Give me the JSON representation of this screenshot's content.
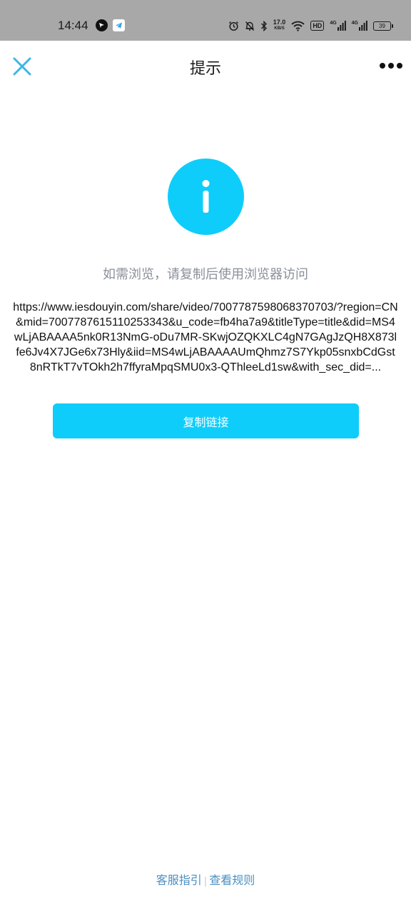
{
  "status_bar": {
    "time": "14:44",
    "net_speed_value": "17.0",
    "net_speed_unit": "KB/S",
    "hd_label": "HD",
    "signal1_label": "4G",
    "signal2_label": "4G",
    "battery": "39",
    "icons": [
      "app-notification-icon",
      "telegram-icon",
      "alarm-icon",
      "mute-bell-icon",
      "bluetooth-icon",
      "wifi-icon",
      "signal-icon",
      "battery-icon"
    ]
  },
  "header": {
    "title": "提示",
    "close_icon": "close-icon",
    "more_icon": "more-icon"
  },
  "main": {
    "info_icon": "info-icon",
    "hint": "如需浏览，请复制后使用浏览器访问",
    "link": "https://www.iesdouyin.com/share/video/7007787598068370703/?region=CN&mid=7007787615110253343&u_code=fb4ha7a9&titleType=title&did=MS4wLjABAAAA5nk0R13NmG-oDu7MR-SKwjOZQKXLC4gN7GAgJzQH8X873lfe6Jv4X7JGe6x73Hly&iid=MS4wLjABAAAAUmQhmz7S7Ykp05snxbCdGst8nRTkT7vTOkh2h7ffyraMpqSMU0x3-QThleeLd1sw&with_sec_did=...",
    "copy_button": "复制链接"
  },
  "footer": {
    "service_guide": "客服指引",
    "separator": "|",
    "view_rules": "查看规则"
  },
  "colors": {
    "accent": "#0ecdfa",
    "close_icon": "#3ab7e6",
    "footer_link": "#4b8fc2",
    "hint_text": "#8a8f99",
    "status_bar_bg": "#a8a8a8"
  }
}
